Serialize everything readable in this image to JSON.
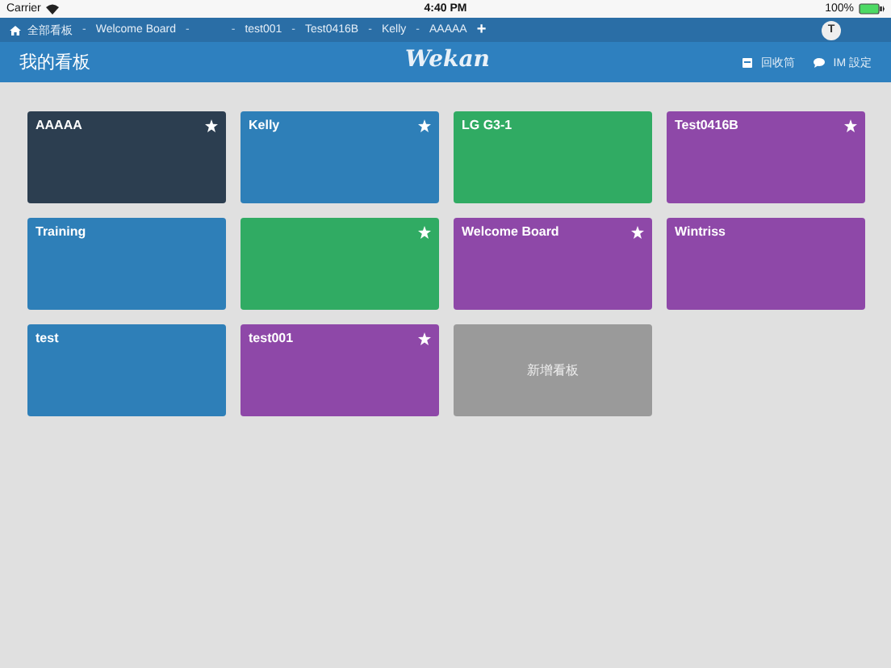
{
  "status_bar": {
    "carrier": "Carrier",
    "time": "4:40 PM",
    "battery": "100%"
  },
  "breadcrumb": {
    "separator": "-",
    "items": [
      {
        "kind": "home",
        "label": "全部看板"
      },
      {
        "kind": "board",
        "label": "Welcome Board"
      },
      {
        "kind": "untitled"
      },
      {
        "kind": "board",
        "label": "test001"
      },
      {
        "kind": "board",
        "label": "Test0416B"
      },
      {
        "kind": "board",
        "label": "Kelly"
      },
      {
        "kind": "board",
        "label": "AAAAA"
      }
    ],
    "add": "+",
    "avatar": "T"
  },
  "header": {
    "title": "我的看板",
    "logo": "Wekan",
    "actions": [
      {
        "kind": "archive",
        "label": "回收筒"
      },
      {
        "kind": "chat",
        "label": "IM 設定"
      }
    ]
  },
  "boards": [
    {
      "kind": "board",
      "title": "AAAAA",
      "color": "#2c3e50",
      "starred": true
    },
    {
      "kind": "board",
      "title": "Kelly",
      "color": "#2e7fb8",
      "starred": true
    },
    {
      "kind": "board",
      "title": "LG G3-1",
      "color": "#30ab63",
      "starred": false
    },
    {
      "kind": "board",
      "title": "Test0416B",
      "color": "#8e48a8",
      "starred": true
    },
    {
      "kind": "board",
      "title": "Training",
      "color": "#2e7fb8",
      "starred": false
    },
    {
      "kind": "board",
      "color": "#30ab63",
      "starred": true
    },
    {
      "kind": "board",
      "title": "Welcome Board",
      "color": "#8e48a8",
      "starred": true
    },
    {
      "kind": "board",
      "title": "Wintriss",
      "color": "#8e48a8",
      "starred": false
    },
    {
      "kind": "board",
      "title": "test",
      "color": "#2e7fb8",
      "starred": false
    },
    {
      "kind": "board",
      "title": "test001",
      "color": "#8e48a8",
      "starred": true
    },
    {
      "kind": "add",
      "title": "新增看板"
    }
  ]
}
